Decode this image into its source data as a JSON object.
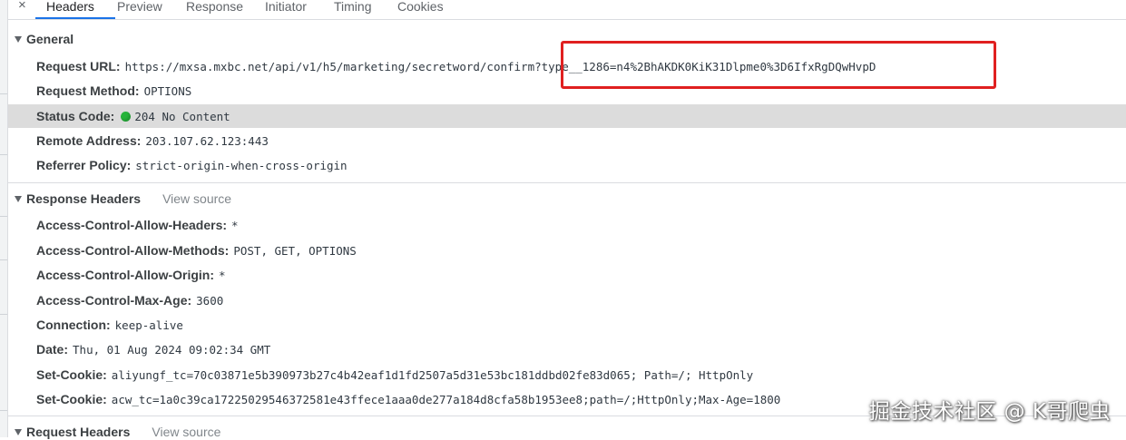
{
  "tabs": {
    "close_icon": "×",
    "items": [
      {
        "label": "Headers",
        "active": true
      },
      {
        "label": "Preview"
      },
      {
        "label": "Response"
      },
      {
        "label": "Initiator"
      },
      {
        "label": "Timing"
      },
      {
        "label": "Cookies"
      }
    ]
  },
  "general": {
    "title": "General",
    "request_url": {
      "name": "Request URL:",
      "value": "https://mxsa.mxbc.net/api/v1/h5/marketing/secretword/confirm?type__1286=n4%2BhAKDK0KiK31Dlpme0%3D6IfxRgDQwHvpD"
    },
    "request_method": {
      "name": "Request Method:",
      "value": "OPTIONS"
    },
    "status_code": {
      "name": "Status Code:",
      "value": "204 No Content",
      "indicator_color": "#26b33a"
    },
    "remote_address": {
      "name": "Remote Address:",
      "value": "203.107.62.123:443"
    },
    "referrer_policy": {
      "name": "Referrer Policy:",
      "value": "strict-origin-when-cross-origin"
    }
  },
  "response_headers": {
    "title": "Response Headers",
    "view_source": "View source",
    "items": [
      {
        "name": "Access-Control-Allow-Headers:",
        "value": "*"
      },
      {
        "name": "Access-Control-Allow-Methods:",
        "value": "POST, GET, OPTIONS"
      },
      {
        "name": "Access-Control-Allow-Origin:",
        "value": "*"
      },
      {
        "name": "Access-Control-Max-Age:",
        "value": "3600"
      },
      {
        "name": "Connection:",
        "value": "keep-alive"
      },
      {
        "name": "Date:",
        "value": "Thu, 01 Aug 2024 09:02:34 GMT"
      },
      {
        "name": "Set-Cookie:",
        "value": "aliyungf_tc=70c03871e5b390973b27c4b42eaf1d1fd2507a5d31e53bc181ddbd02fe83d065; Path=/; HttpOnly"
      },
      {
        "name": "Set-Cookie:",
        "value": "acw_tc=1a0c39ca17225029546372581e43ffece1aaa0de277a184d8cfa58b1953ee8;path=/;HttpOnly;Max-Age=1800"
      }
    ]
  },
  "request_headers": {
    "title": "Request Headers",
    "view_source": "View source"
  },
  "annotation": {
    "color": "#e02020"
  },
  "watermark": "掘金技术社区 @ K哥爬虫"
}
